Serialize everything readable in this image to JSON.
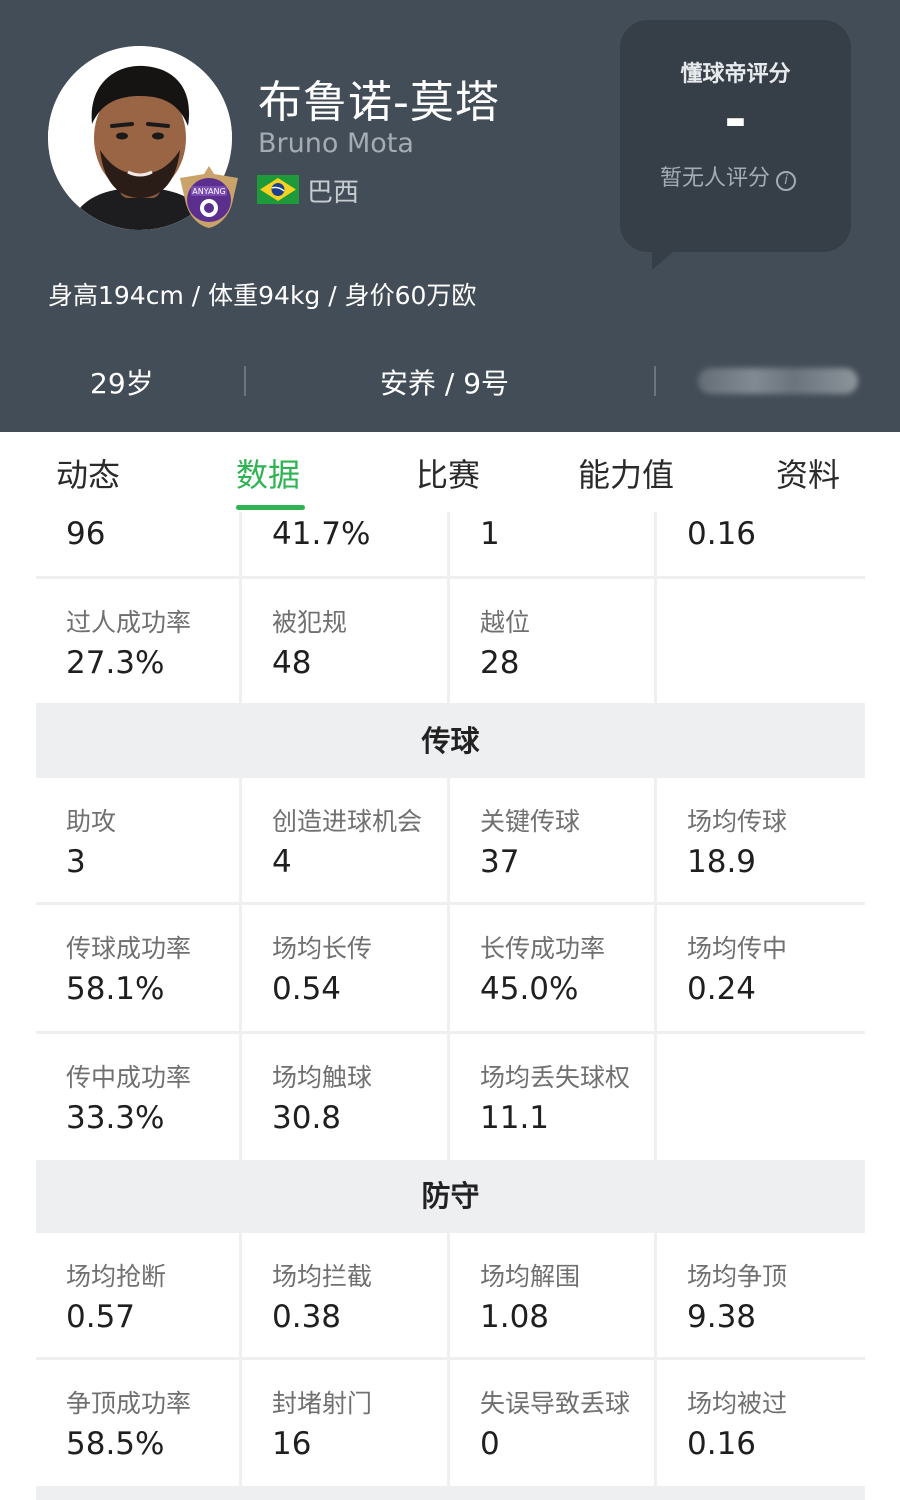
{
  "player": {
    "name_cn": "布鲁诺-莫塔",
    "name_en": "Bruno Mota",
    "nationality": "巴西",
    "bio": "身高194cm / 体重94kg / 身价60万欧",
    "age": "29岁",
    "team_number": "安养 / 9号",
    "club_badge_text": "ANYANG"
  },
  "rating": {
    "title": "懂球帝评分",
    "value": "-",
    "note": "暂无人评分",
    "info_icon": "i"
  },
  "tabs": [
    {
      "label": "动态"
    },
    {
      "label": "数据"
    },
    {
      "label": "比赛"
    },
    {
      "label": "能力值"
    },
    {
      "label": "资料"
    }
  ],
  "active_tab": "数据",
  "stats": {
    "top_row": [
      {
        "value": "96"
      },
      {
        "value": "41.7%"
      },
      {
        "value": "1"
      },
      {
        "value": "0.16"
      }
    ],
    "attack_row2": [
      {
        "label": "过人成功率",
        "value": "27.3%"
      },
      {
        "label": "被犯规",
        "value": "48"
      },
      {
        "label": "越位",
        "value": "28"
      },
      {
        "label": "",
        "value": ""
      }
    ],
    "passing_title": "传球",
    "passing": [
      [
        {
          "label": "助攻",
          "value": "3"
        },
        {
          "label": "创造进球机会",
          "value": "4"
        },
        {
          "label": "关键传球",
          "value": "37"
        },
        {
          "label": "场均传球",
          "value": "18.9"
        }
      ],
      [
        {
          "label": "传球成功率",
          "value": "58.1%"
        },
        {
          "label": "场均长传",
          "value": "0.54"
        },
        {
          "label": "长传成功率",
          "value": "45.0%"
        },
        {
          "label": "场均传中",
          "value": "0.24"
        }
      ],
      [
        {
          "label": "传中成功率",
          "value": "33.3%"
        },
        {
          "label": "场均触球",
          "value": "30.8"
        },
        {
          "label": "场均丢失球权",
          "value": "11.1"
        },
        {
          "label": "",
          "value": ""
        }
      ]
    ],
    "defense_title": "防守",
    "defense": [
      [
        {
          "label": "场均抢断",
          "value": "0.57"
        },
        {
          "label": "场均拦截",
          "value": "0.38"
        },
        {
          "label": "场均解围",
          "value": "1.08"
        },
        {
          "label": "场均争顶",
          "value": "9.38"
        }
      ],
      [
        {
          "label": "争顶成功率",
          "value": "58.5%"
        },
        {
          "label": "封堵射门",
          "value": "16"
        },
        {
          "label": "失误导致丢球",
          "value": "0"
        },
        {
          "label": "场均被过",
          "value": "0.16"
        }
      ]
    ]
  },
  "colors": {
    "header_bg": "#434d57",
    "rating_bg": "#363e47",
    "accent_green": "#2fb353",
    "grid_bg": "#eeeff1"
  }
}
